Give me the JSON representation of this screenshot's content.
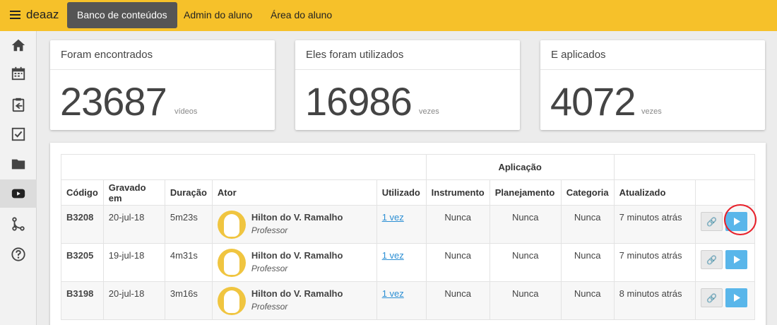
{
  "app": {
    "brand": "deaaz",
    "tabs": [
      {
        "label": "Banco de conteúdos",
        "active": true
      },
      {
        "label": "Admin do aluno",
        "active": false
      },
      {
        "label": "Área do aluno",
        "active": false
      }
    ],
    "accent_color": "#f6c12a"
  },
  "sidebar": {
    "items": [
      {
        "icon": "home-icon",
        "active": false
      },
      {
        "icon": "calendar-icon",
        "active": false
      },
      {
        "icon": "clipboard-icon",
        "active": false
      },
      {
        "icon": "checkbox-icon",
        "active": false
      },
      {
        "icon": "folder-icon",
        "active": false
      },
      {
        "icon": "video-icon",
        "active": true
      },
      {
        "icon": "flow-icon",
        "active": false
      },
      {
        "icon": "help-icon",
        "active": false
      }
    ]
  },
  "stats": [
    {
      "title": "Foram encontrados",
      "value": "23687",
      "unit": "vídeos"
    },
    {
      "title": "Eles foram utilizados",
      "value": "16986",
      "unit": "vezes"
    },
    {
      "title": "E aplicados",
      "value": "4072",
      "unit": "vezes"
    }
  ],
  "table": {
    "group_header": "Aplicação",
    "columns": [
      "Código",
      "Gravado em",
      "Duração",
      "Ator",
      "Utilizado",
      "Instrumento",
      "Planejamento",
      "Categoria",
      "Atualizado"
    ],
    "rows": [
      {
        "code": "B3208",
        "recorded": "20-jul-18",
        "duration": "5m23s",
        "actor": "Hilton do V. Ramalho",
        "role": "Professor",
        "used": "1 vez",
        "instrument": "Nunca",
        "planning": "Nunca",
        "category": "Nunca",
        "updated": "7 minutos atrás"
      },
      {
        "code": "B3205",
        "recorded": "19-jul-18",
        "duration": "4m31s",
        "actor": "Hilton do V. Ramalho",
        "role": "Professor",
        "used": "1 vez",
        "instrument": "Nunca",
        "planning": "Nunca",
        "category": "Nunca",
        "updated": "7 minutos atrás"
      },
      {
        "code": "B3198",
        "recorded": "20-jul-18",
        "duration": "3m16s",
        "actor": "Hilton do V. Ramalho",
        "role": "Professor",
        "used": "1 vez",
        "instrument": "Nunca",
        "planning": "Nunca",
        "category": "Nunca",
        "updated": "8 minutos atrás"
      }
    ]
  }
}
